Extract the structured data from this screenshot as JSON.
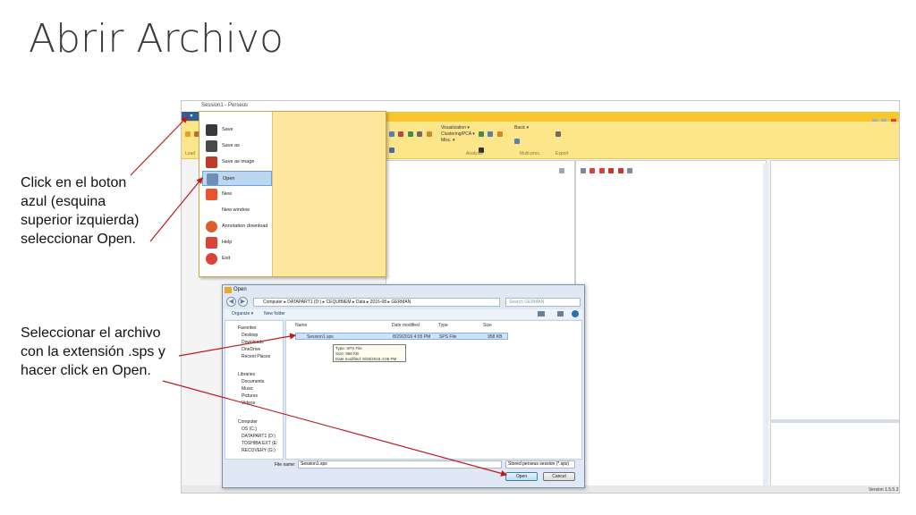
{
  "slide": {
    "title": "Abrir Archivo",
    "note_1": "Click en el boton azul (esquina superior izquierda) seleccionar Open.",
    "note_2": "Seleccionar el archivo con la extensión .sps y hacer click en Open."
  },
  "app": {
    "window_title": "Session1 - Perseus",
    "ribbon": {
      "analysis": [
        "Visualization ▾",
        "Clustering/PCA ▾",
        "Misc. ▾"
      ],
      "basic": "Basic ▾",
      "group_labels": [
        "Load",
        "Analysis",
        "Multi-proc.",
        "Export"
      ]
    },
    "version": "Version 1.5.5.3"
  },
  "file_menu": {
    "items": [
      {
        "label": "Save",
        "icon": "save-icon"
      },
      {
        "label": "Save as",
        "icon": "save-as-icon"
      },
      {
        "label": "Save as image",
        "icon": "pdf-icon"
      },
      {
        "label": "Open",
        "icon": "open-icon"
      },
      {
        "label": "New",
        "icon": "new-icon"
      },
      {
        "label": "New window",
        "icon": "new-window-icon"
      },
      {
        "label": "Annotation download",
        "icon": "annotation-icon"
      },
      {
        "label": "Help",
        "icon": "help-icon"
      },
      {
        "label": "Exit",
        "icon": "exit-icon"
      }
    ],
    "selected": "Open"
  },
  "open_dialog": {
    "title": "Open",
    "address": "Computer ▸ DATAPART1 (D:) ▸ CEQUIBIEM ▸ Data ▸ 2016-08 ▸ GERMAN",
    "search_placeholder": "Search GERMAN",
    "organize_label": "Organize ▾",
    "new_folder_label": "New folder",
    "nav": {
      "favorites": [
        "Favorites",
        "Desktop",
        "Downloads",
        "OneDrive",
        "Recent Places"
      ],
      "libraries": [
        "Libraries",
        "Documents",
        "Music",
        "Pictures",
        "Videos"
      ],
      "computer": [
        "Computer",
        "OS (C:)",
        "DATAPART1 (D:)",
        "TOSHIBA EXT (E:",
        "RECOVERY (G:)"
      ]
    },
    "columns": [
      "Name",
      "Date modified",
      "Type",
      "Size"
    ],
    "files": [
      {
        "name": "Session1.sps",
        "date": "8/29/2016 4:05 PM",
        "type": "SPS File",
        "size": "958 KB"
      }
    ],
    "tooltip": [
      "Type: SPS File",
      "Size: 958 KB",
      "Date modified: 8/29/2016 4:05 PM"
    ],
    "file_name_label": "File name:",
    "file_name_value": "Session1.sps",
    "filter": "Stored perseus session (*.sps)",
    "open_button": "Open",
    "cancel_button": "Cancel"
  }
}
